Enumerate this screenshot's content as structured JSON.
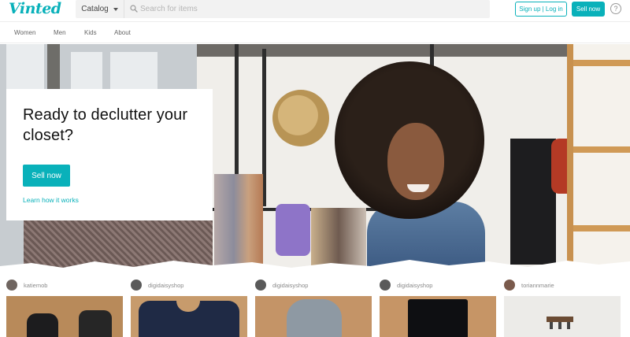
{
  "header": {
    "logo": "Vinted",
    "catalog_label": "Catalog",
    "search_placeholder": "Search for items",
    "signup_label": "Sign up | Log in",
    "sell_label": "Sell now",
    "help_glyph": "?"
  },
  "nav": {
    "items": [
      {
        "label": "Women"
      },
      {
        "label": "Men"
      },
      {
        "label": "Kids"
      },
      {
        "label": "About"
      }
    ]
  },
  "hero": {
    "title": "Ready to declutter your closet?",
    "cta_label": "Sell now",
    "link_label": "Learn how it works"
  },
  "products": [
    {
      "seller": "katiemob"
    },
    {
      "seller": "digidaisyshop"
    },
    {
      "seller": "digidaisyshop"
    },
    {
      "seller": "digidaisyshop"
    },
    {
      "seller": "toriannmarie"
    }
  ],
  "colors": {
    "brand": "#09b1ba"
  },
  "icons": {
    "search": "search-icon",
    "catalog_caret": "chevron-down-icon",
    "help": "help-icon"
  }
}
